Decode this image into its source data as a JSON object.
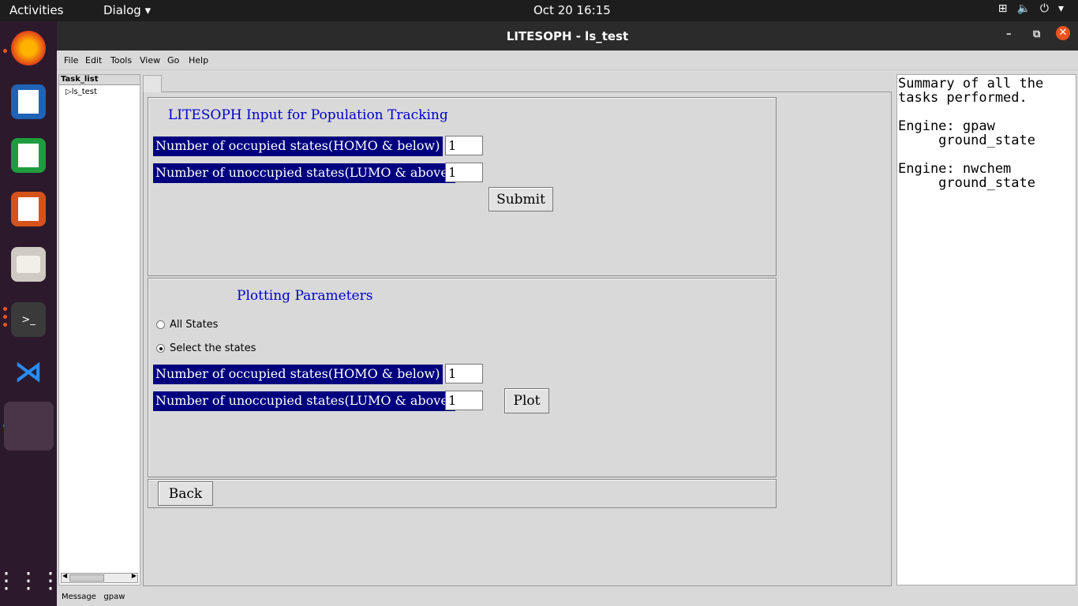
{
  "topbar": {
    "activities": "Activities",
    "app_menu": "Dialog",
    "clock": "Oct 20  16:15"
  },
  "window": {
    "title": "LITESOPH - ls_test"
  },
  "menu": [
    "File",
    "Edit",
    "Tools",
    "View",
    "Go",
    "Help"
  ],
  "task_list": {
    "header": "Task_list",
    "item": "ls_test"
  },
  "tracking": {
    "heading": "LITESOPH Input for Population Tracking",
    "occupied_label": "Number of occupied states(HOMO & below)",
    "occupied_value": "1",
    "unoccupied_label": "Number of unoccupied states(LUMO & above)",
    "unoccupied_value": "1",
    "submit": "Submit"
  },
  "plotting": {
    "heading": "Plotting Parameters",
    "radio_all": "All States",
    "radio_select": "Select the states",
    "selected": "select",
    "occupied_label": "Number of occupied states(HOMO & below)",
    "occupied_value": "1",
    "unoccupied_label": "Number of unoccupied states(LUMO & above)",
    "unoccupied_value": "1",
    "plot": "Plot"
  },
  "back": "Back",
  "summary": "Summary of all the\ntasks performed.\n\nEngine: gpaw\n     ground_state\n\nEngine: nwchem\n     ground_state",
  "status": {
    "label": "Message",
    "value": "gpaw"
  },
  "colors": {
    "label_bg": "#00007f",
    "heading": "#0000c8",
    "dock": "#2c1a2c",
    "accent": "#e95420"
  }
}
